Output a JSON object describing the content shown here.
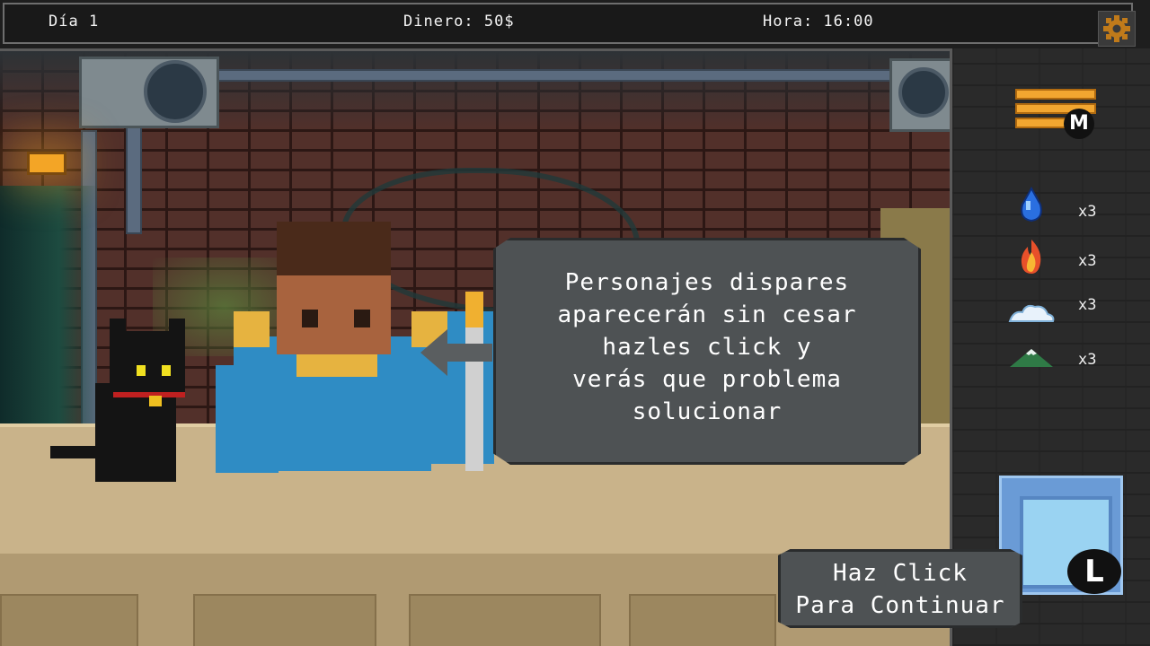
{
  "hud": {
    "day": "Día 1",
    "money": "Dinero: 50$",
    "time": "Hora: 16:00",
    "settings_icon": "gear-icon"
  },
  "dialog": {
    "text": "Personajes dispares\naparecerán sin cesar\nhazles click y\nverás que problema\nsolucionar"
  },
  "sidebar": {
    "menu_key": "M",
    "resources": [
      {
        "icon": "water-drop-icon",
        "count": "x3"
      },
      {
        "icon": "fire-icon",
        "count": "x3"
      },
      {
        "icon": "cloud-icon",
        "count": "x3"
      },
      {
        "icon": "mountain-icon",
        "count": "x3"
      }
    ],
    "l_key": "L"
  },
  "continue_button": {
    "line1": "Haz Click",
    "line2": "Para Continuar"
  },
  "colors": {
    "accent_orange": "#f2a630",
    "dialog_bg": "#4e5254",
    "customer_shirt": "#2f8cc4",
    "customer_gold": "#e6b340"
  }
}
